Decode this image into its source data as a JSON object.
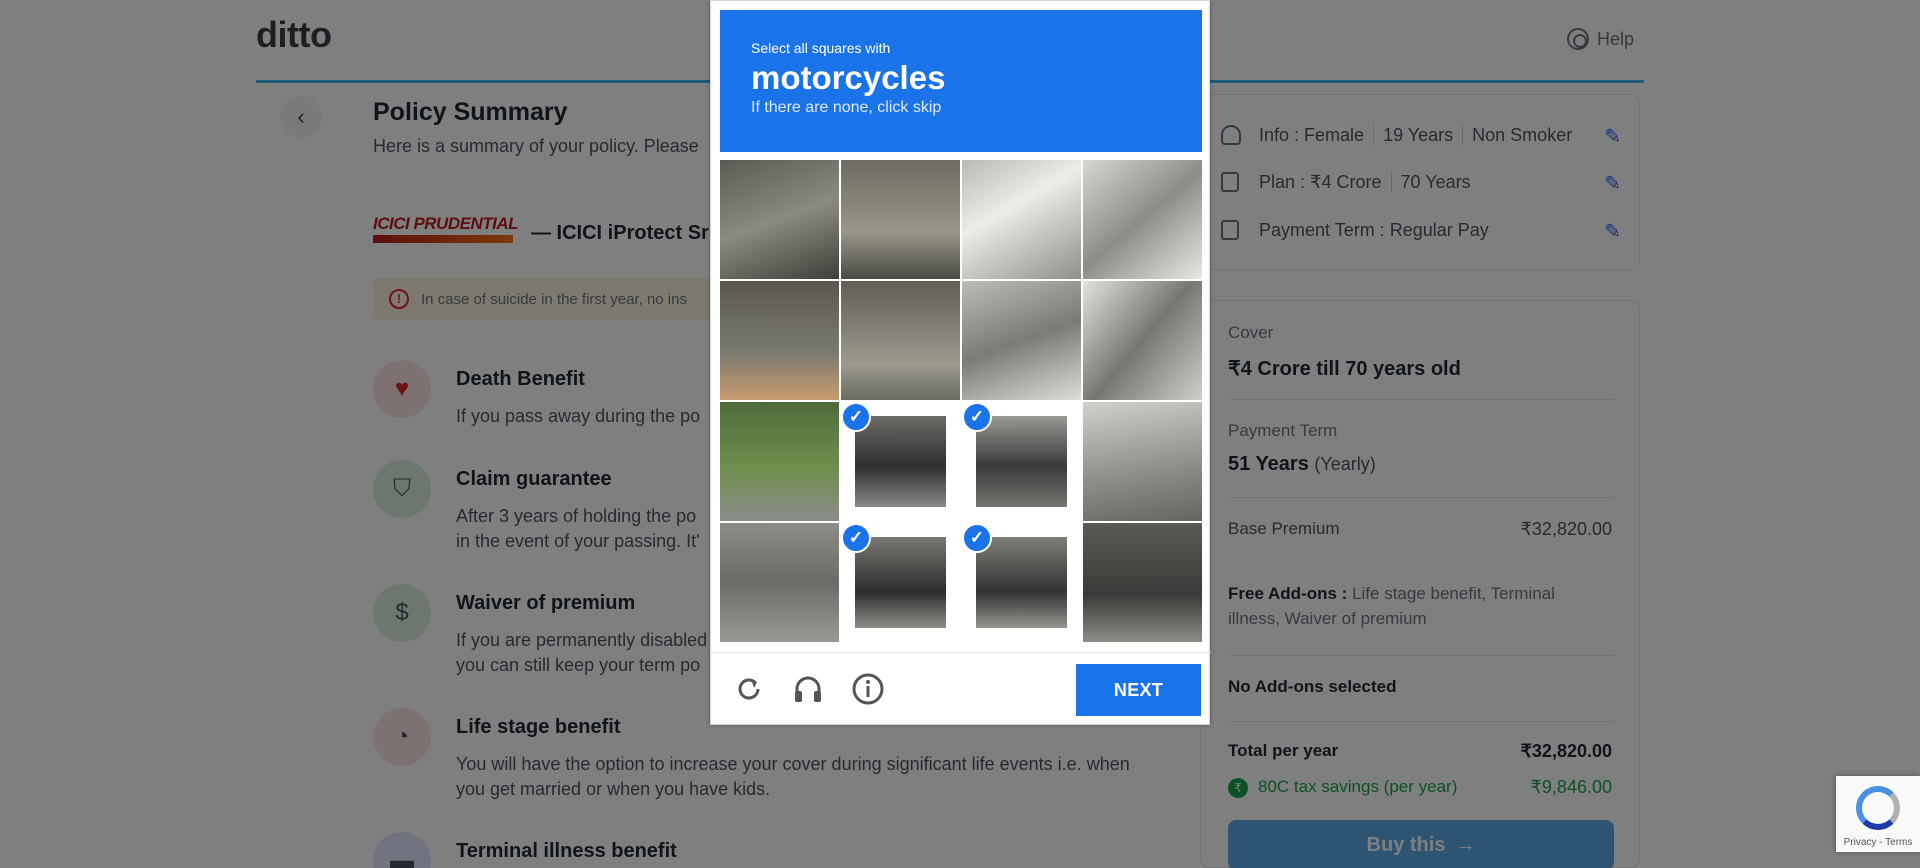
{
  "header": {
    "logo": "ditto",
    "help_label": "Help"
  },
  "page": {
    "title": "Policy Summary",
    "subtitle": "Here is a summary of your policy. Please",
    "insurer_logo_line1": "ICICI PRUDENTIAL",
    "product_name": "— ICICI iProtect Sr",
    "warning": "In case of suicide in the first year, no ins"
  },
  "benefits": [
    {
      "title": "Death Benefit",
      "desc": "If you pass away during the po"
    },
    {
      "title": "Claim guarantee",
      "desc": "After 3 years of holding the po",
      "desc2": "in the event of your passing. It'"
    },
    {
      "title": "Waiver of premium",
      "desc": "If you are permanently disabled",
      "desc2": "you can still keep your term po"
    },
    {
      "title": "Life stage benefit",
      "desc": "You will have the option to increase your cover during significant life events i.e. when",
      "desc2": "you get married or when you have kids."
    },
    {
      "title": "Terminal illness benefit"
    }
  ],
  "profile": {
    "info_label": "Info :",
    "gender": "Female",
    "age": "19 Years",
    "smoker": "Non Smoker",
    "plan_label": "Plan :",
    "cover": "₹4 Crore",
    "term": "70 Years",
    "payment_label": "Payment Term :",
    "payment": "Regular Pay"
  },
  "summary": {
    "cover_label": "Cover",
    "cover_value": "₹4 Crore till 70 years old",
    "payment_term_label": "Payment Term",
    "payment_term_value": "51 Years",
    "payment_term_unit": "(Yearly)",
    "base_premium_label": "Base Premium",
    "base_premium_value": "₹32,820.00",
    "free_addons_label": "Free Add-ons :",
    "free_addons_value": "Life stage benefit, Terminal illness, Waiver of premium",
    "no_addons": "No Add-ons selected",
    "total_label": "Total per year",
    "total_value": "₹32,820.00",
    "tax_label": "80C tax savings (per year)",
    "tax_value": "₹9,846.00",
    "buy_label": "Buy this"
  },
  "captcha": {
    "instruction_pre": "Select all squares with",
    "keyword": "motorcycles",
    "instruction_post": "If there are none, click skip",
    "next_label": "NEXT",
    "grid_size": 4,
    "selected_tiles": [
      9,
      10,
      13,
      14
    ],
    "icons": [
      "reload-icon",
      "audio-icon",
      "info-icon"
    ]
  },
  "recaptcha_badge": {
    "text": "Privacy - Terms"
  },
  "colors": {
    "accent": "#1a73e8",
    "brand_line": "#3bb5e8",
    "buy": "#5aa9e6"
  }
}
